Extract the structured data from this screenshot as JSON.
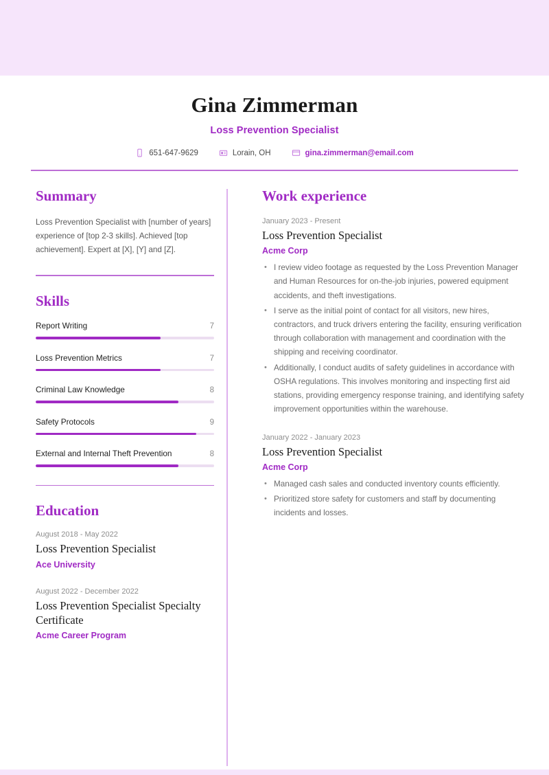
{
  "theme": {
    "accent": "#a02ac4",
    "band": "#f6e5fb",
    "rule": "#bd6ed6",
    "track": "#ecdef1",
    "divider": "#deb0ee"
  },
  "header": {
    "full_name": "Gina Zimmerman",
    "job_title": "Loss Prevention Specialist",
    "contacts": [
      {
        "icon": "phone-icon",
        "text": "651-647-9629"
      },
      {
        "icon": "location-icon",
        "text": "Lorain, OH"
      },
      {
        "icon": "email-icon",
        "text": "gina.zimmerman@email.com"
      }
    ]
  },
  "summary": {
    "title": "Summary",
    "text": "Loss Prevention Specialist with [number of years] experience of [top 2-3 skills]. Achieved [top achievement]. Expert at [X], [Y] and [Z]."
  },
  "skills": {
    "title": "Skills",
    "max": 10,
    "items": [
      {
        "name": "Report Writing",
        "score": "7",
        "percent": "70%"
      },
      {
        "name": "Loss Prevention Metrics",
        "score": "7",
        "percent": "70%"
      },
      {
        "name": "Criminal Law Knowledge",
        "score": "8",
        "percent": "80%"
      },
      {
        "name": "Safety Protocols",
        "score": "9",
        "percent": "90%"
      },
      {
        "name": "External and Internal Theft Prevention",
        "score": "8",
        "percent": "80%"
      }
    ]
  },
  "education": {
    "title": "Education",
    "items": [
      {
        "date": "August 2018 - May 2022",
        "degree": "Loss Prevention Specialist",
        "school": "Ace University"
      },
      {
        "date": "August 2022 - December 2022",
        "degree": "Loss Prevention Specialist Specialty Certificate",
        "school": "Acme Career Program"
      }
    ]
  },
  "work_experience": {
    "title": "Work experience",
    "items": [
      {
        "date": "January 2023 - Present",
        "role": "Loss Prevention Specialist",
        "company": "Acme Corp",
        "bullets": [
          "I review video footage as requested by the Loss Prevention Manager and Human Resources for on-the-job injuries, powered equipment accidents, and theft investigations.",
          "I serve as the initial point of contact for all visitors, new hires, contractors, and truck drivers entering the facility, ensuring verification through collaboration with management and coordination with the shipping and receiving coordinator.",
          "Additionally, I conduct audits of safety guidelines in accordance with OSHA regulations. This involves monitoring and inspecting first aid stations, providing emergency response training, and identifying safety improvement opportunities within the warehouse."
        ]
      },
      {
        "date": "January 2022 - January 2023",
        "role": "Loss Prevention Specialist",
        "company": "Acme Corp",
        "bullets": [
          "Managed cash sales and conducted inventory counts efficiently.",
          "Prioritized store safety for customers and staff by documenting incidents and losses."
        ]
      }
    ]
  }
}
